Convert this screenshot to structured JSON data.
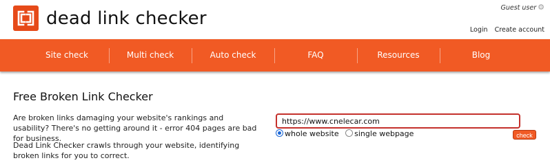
{
  "brand": {
    "name": "dead link checker",
    "logo_icon": "dlc-logo-icon",
    "color": "#f15a24"
  },
  "header": {
    "guest_label": "Guest user",
    "guest_icon": "gear-icon",
    "login_label": "Login",
    "create_account_label": "Create account"
  },
  "nav": {
    "items": [
      {
        "label": "Site check"
      },
      {
        "label": "Multi check"
      },
      {
        "label": "Auto check"
      },
      {
        "label": "FAQ"
      },
      {
        "label": "Resources"
      },
      {
        "label": "Blog"
      }
    ]
  },
  "main": {
    "title": "Free Broken Link Checker",
    "paragraph1": "Are broken links damaging your website's rankings and usability? There's no getting around it - error 404 pages are bad for business.",
    "paragraph2": "Dead Link Checker crawls through your website, identifying broken links for you to correct."
  },
  "form": {
    "url_value": "https://www.cnelecar.com",
    "option_whole": "whole website",
    "option_single": "single webpage",
    "selected": "whole website",
    "check_label": "check"
  }
}
